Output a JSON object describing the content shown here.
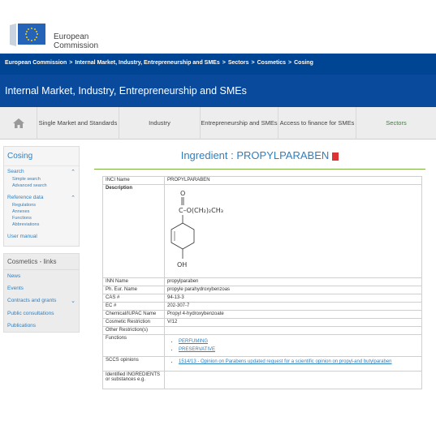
{
  "header": {
    "org_line1": "European",
    "org_line2": "Commission"
  },
  "breadcrumb": {
    "items": [
      "European Commission",
      "Internal Market, Industry, Entrepreneurship and SMEs",
      "Sectors",
      "Cosmetics",
      "Cosing"
    ],
    "separator": ">"
  },
  "title_bar": {
    "title": "Internal Market, Industry, Entrepreneurship and SMEs"
  },
  "nav": {
    "items": [
      {
        "label": "Single Market and Standards"
      },
      {
        "label": "Industry"
      },
      {
        "label": "Entrepreneurship and SMEs"
      },
      {
        "label": "Access to finance for SMEs"
      },
      {
        "label": "Sectors"
      }
    ]
  },
  "sidebar": {
    "title": "Cosing",
    "search": {
      "label": "Search",
      "items": [
        "Simple search",
        "Advanced search"
      ]
    },
    "reference": {
      "label": "Reference data",
      "items": [
        "Regulations",
        "Annexes",
        "Functions",
        "Abbreviations"
      ]
    },
    "user_manual": "User manual",
    "links_title": "Cosmetics - links",
    "links": [
      "News",
      "Events",
      "Contracts and grants",
      "Public consultations",
      "Publications"
    ]
  },
  "ingredient": {
    "heading": "Ingredient : PROPYLPARABEN",
    "rows": [
      {
        "key": "INCI Name",
        "value": "PROPYLPARABEN"
      },
      {
        "key": "Description",
        "value": ""
      },
      {
        "key": "INN Name",
        "value": "propylparaben"
      },
      {
        "key": "Ph. Eur. Name",
        "value": "propyle parahydroxybenzoas"
      },
      {
        "key": "CAS #",
        "value": "94-13-3"
      },
      {
        "key": "EC #",
        "value": "202-307-7"
      },
      {
        "key": "Chemical/IUPAC Name",
        "value": "Propyl 4-hydroxybenzoate"
      },
      {
        "key": "Cosmetic Restriction",
        "value": "V/12"
      },
      {
        "key": "Other Restriction(s)",
        "value": ""
      },
      {
        "key": "Functions",
        "value": ""
      },
      {
        "key": "SCCS opinions",
        "value": ""
      },
      {
        "key": "Identified INGREDIENTS or substances e.g.",
        "value": ""
      }
    ],
    "functions": [
      "PERFUMING",
      "PRESERVATIVE"
    ],
    "sccs_opinion": "1514/13 - Opinion on Parabens updated request for a scientific opinion on propyl-and butylparaben",
    "structure": {
      "top": "O",
      "ester": "C–O(CH₂)₂CH₃",
      "bottom": "OH"
    }
  }
}
